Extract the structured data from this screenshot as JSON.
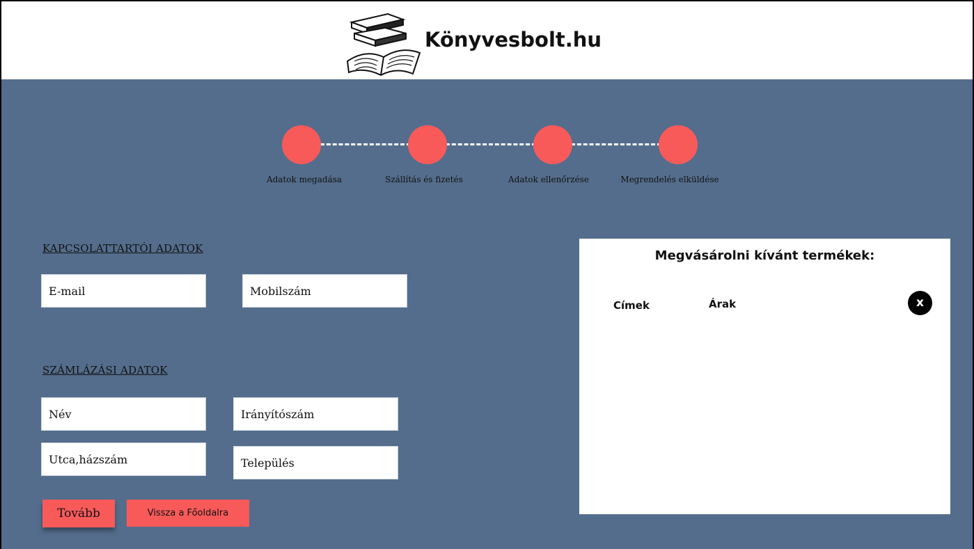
{
  "header": {
    "site_name": "Könyvesbolt.hu",
    "logo_icon": "books-icon"
  },
  "colors": {
    "background": "#546d8c",
    "accent": "#f85a5a",
    "panel": "#ffffff"
  },
  "steps": [
    {
      "label": "Adatok megadása"
    },
    {
      "label": "Szállítás és fizetés"
    },
    {
      "label": "Adatok ellenőrzése"
    },
    {
      "label": "Megrendelés elküldése"
    }
  ],
  "contact": {
    "title": "KAPCSOLATTARTÓI ADATOK",
    "email_placeholder": "E-mail",
    "phone_placeholder": "Mobilszám"
  },
  "billing": {
    "title": "SZÁMLÁZÁSI ADATOK",
    "name_placeholder": "Név",
    "zip_placeholder": "Irányítószám",
    "street_placeholder": "Utca,házszám",
    "city_placeholder": "Település"
  },
  "buttons": {
    "next": "Tovább",
    "back_home": "Vissza a Főoldalra"
  },
  "cart": {
    "title": "Megvásárolni kívánt termékek:",
    "col_titles": "Címek",
    "col_prices": "Árak",
    "close_label": "x"
  }
}
